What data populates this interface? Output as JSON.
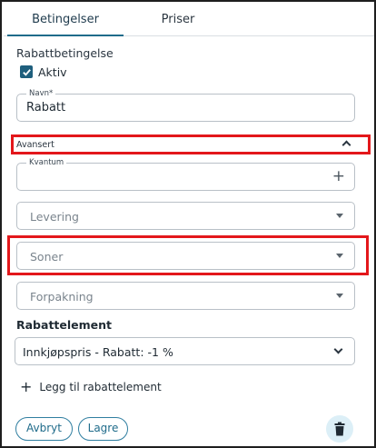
{
  "tabs": [
    {
      "label": "Betingelser",
      "active": true
    },
    {
      "label": "Priser",
      "active": false
    }
  ],
  "condition": {
    "section_title": "Rabattbetingelse",
    "active_label": "Aktiv",
    "active_checked": true,
    "name_label": "Navn*",
    "name_value": "Rabatt"
  },
  "advanced": {
    "label": "Avansert",
    "expanded": true,
    "quantity_label": "Kvantum",
    "quantity_value": "",
    "delivery_placeholder": "Levering",
    "zones_placeholder": "Soner",
    "packaging_placeholder": "Forpakning"
  },
  "elements": {
    "title": "Rabattelement",
    "selected": "Innkjøpspris - Rabatt: -1 %",
    "add_label": "Legg til rabattelement"
  },
  "actions": {
    "cancel_label": "Avbryt",
    "save_label": "Lagre"
  },
  "colors": {
    "accent": "#1f6b8a",
    "highlight": "#e3171b",
    "trash_bg": "#dceff7"
  },
  "icons": [
    "check-icon",
    "chevron-up-icon",
    "plus-icon",
    "caret-down-icon",
    "chevron-down-icon",
    "trash-icon"
  ]
}
